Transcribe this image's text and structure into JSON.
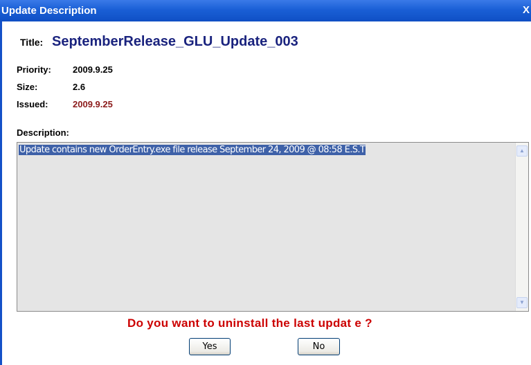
{
  "window": {
    "title": "Update Description",
    "close_label": "X"
  },
  "update": {
    "title_label": "Title:",
    "title_value": "SeptemberRelease_GLU_Update_003",
    "priority_label": "Priority:",
    "priority_value": "2009.9.25",
    "size_label": "Size:",
    "size_value": "2.6",
    "issued_label": "Issued:",
    "issued_value": "2009.9.25",
    "description_label": "Description:",
    "description_text": "Update contains new OrderEntry.exe file release September 24, 2009 @ 08:58 E.S.T"
  },
  "prompt": {
    "question": "Do you want to uninstall the last updat e ?",
    "yes_label": "Yes",
    "no_label": "No"
  },
  "colors": {
    "title_bar": "#1a5fd6",
    "title_value": "#1a237e",
    "issued_value": "#8b1a1a",
    "question": "#cc0000"
  },
  "icons": {
    "close": "close-icon",
    "scroll_up": "chevron-up-icon",
    "scroll_down": "chevron-down-icon"
  }
}
